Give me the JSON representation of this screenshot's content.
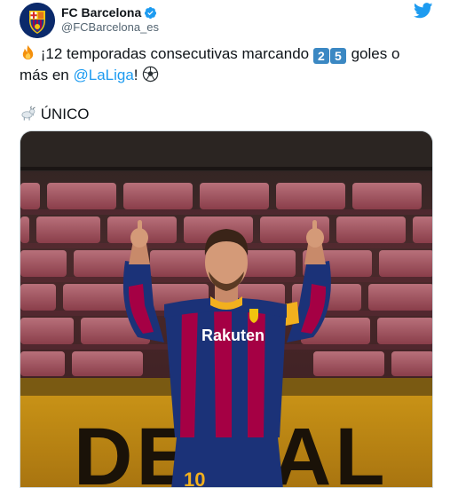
{
  "author": {
    "name": "FC Barcelona",
    "handle": "@FCBarcelona_es",
    "verified_icon": "verified-badge-icon",
    "avatar_icon": "fc-barcelona-crest-icon"
  },
  "platform_icon": "twitter-bird-icon",
  "tweet": {
    "line1_text": "¡12 temporadas consecutivas marcando",
    "keycap_1": "2",
    "keycap_2": "5",
    "line1_suffix": "goles o",
    "line2_prefix": "más en",
    "mention": "@LaLiga",
    "line2_suffix": "!",
    "line3_text": "ÚNICO",
    "emojis": [
      "fire-emoji",
      "soccer-ball-emoji",
      "goat-emoji"
    ]
  },
  "media": {
    "shirt_sponsor": "Rakuten",
    "shirt_number": "10",
    "board_text": "DE VAL"
  },
  "colors": {
    "mention": "#1d9bf0",
    "handle": "#536471",
    "keycap": "#3b88c3",
    "twitter_blue": "#1d9bf0"
  }
}
